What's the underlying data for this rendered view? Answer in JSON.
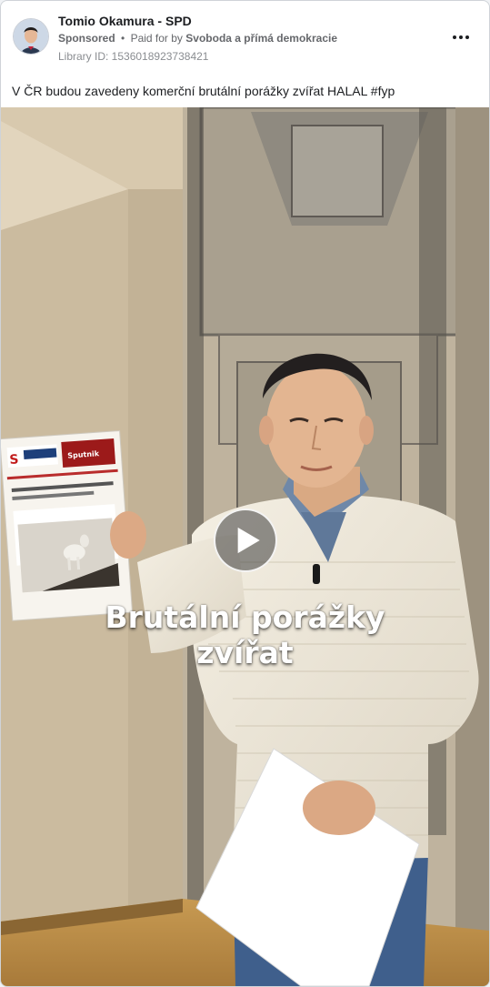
{
  "ad": {
    "page_name": "Tomio Okamura - SPD",
    "sponsored_label": "Sponsored",
    "separator": "•",
    "paid_for_prefix": "Paid for by",
    "paid_for_by": "Svoboda a přímá demokracie",
    "library_id": "Library ID: 1536018923738421",
    "more_icon": "more-horizontal-icon"
  },
  "post": {
    "text": "V ČR budou zavedeny komerční brutální porážky zvířat HALAL #fyp"
  },
  "video": {
    "caption_line1": "Brutální porážky",
    "caption_line2": "zvířat",
    "play_icon": "play-icon",
    "newspaper_headline": "Sputnik"
  },
  "colors": {
    "text_primary": "#1c1e21",
    "text_secondary": "#65676b",
    "card_border": "#cfd3d8"
  }
}
